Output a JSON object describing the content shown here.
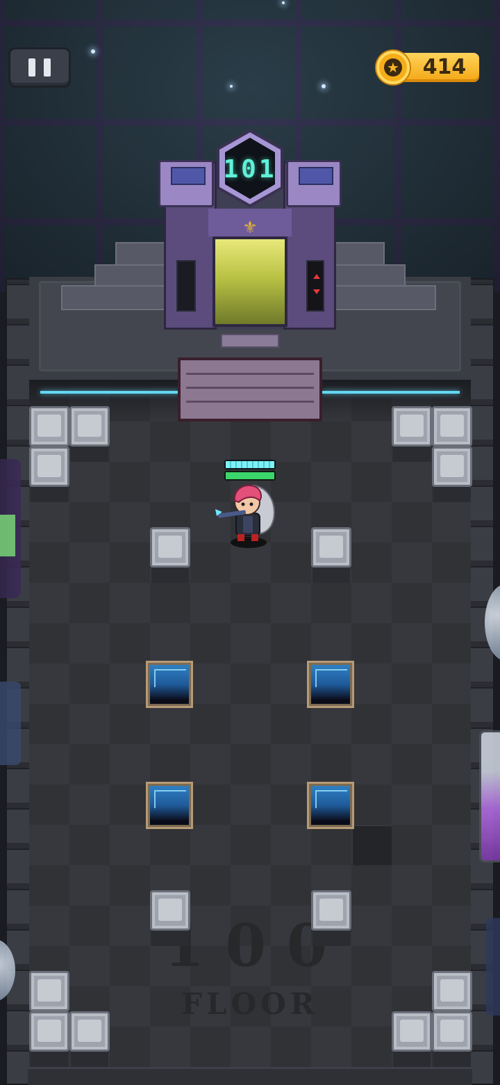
{
  "hud": {
    "pause_label": "Pause",
    "coins": "414"
  },
  "elevator": {
    "floor_number": "101",
    "emblem": "⚜"
  },
  "floor": {
    "number": "100",
    "word": "FLOOR"
  },
  "player": {
    "health": 1.0,
    "energy": 1.0
  },
  "colors": {
    "accent_coin": "#f3a614",
    "floor_number_glow": "#5ff1d8",
    "laser": "#63d6f2",
    "health": "#7ff1f5",
    "energy": "#3cd56b"
  },
  "icons": [
    "pause-icon",
    "coin-icon",
    "star-icon"
  ]
}
